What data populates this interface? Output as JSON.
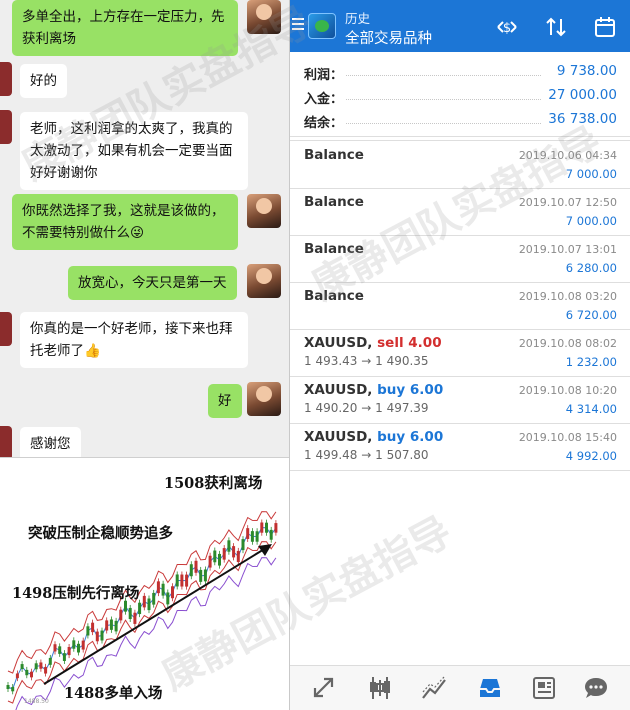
{
  "chat": {
    "messages": [
      {
        "side": "right",
        "text": "多单全出，上方存在一定压力，先获利离场"
      },
      {
        "side": "left",
        "text": "好的"
      },
      {
        "side": "left",
        "text": "老师，这利润拿的太爽了，我真的太激动了，如果有机会一定要当面好好谢谢你"
      },
      {
        "side": "right",
        "text": "你既然选择了我，这就是该做的，不需要特别做什么😜"
      },
      {
        "side": "right",
        "text": "放宽心，今天只是第一天"
      },
      {
        "side": "left",
        "text": "你真的是一个好老师，接下来也拜托老师了👍"
      },
      {
        "side": "right",
        "text": "好"
      },
      {
        "side": "left",
        "text": "感谢您"
      }
    ]
  },
  "chart_annotations": {
    "take_profit": "1508获利离场",
    "breakout": "突破压制企稳顺势追多",
    "first_exit": "1498压制先行离场",
    "entry": "1488多单入场",
    "axis_tick": "1488.50"
  },
  "mt4": {
    "app_title": "历史",
    "app_subtitle": "全部交易品种",
    "summary": [
      {
        "label": "利润：",
        "value": "9 738.00"
      },
      {
        "label": "入金：",
        "value": "27 000.00"
      },
      {
        "label": "结余：",
        "value": "36 738.00"
      }
    ],
    "balances": [
      {
        "title": "Balance",
        "date": "2019.10.06 04:34",
        "amount": "7 000.00"
      },
      {
        "title": "Balance",
        "date": "2019.10.07 12:50",
        "amount": "7 000.00"
      },
      {
        "title": "Balance",
        "date": "2019.10.07 13:01",
        "amount": "6 280.00"
      },
      {
        "title": "Balance",
        "date": "2019.10.08 03:20",
        "amount": "6 720.00"
      }
    ],
    "deals": [
      {
        "symbol": "XAUUSD,",
        "side": "sell",
        "side_text": "sell 4.00",
        "prices": "1 493.43 → 1 490.35",
        "date": "2019.10.08 08:02",
        "amount": "1 232.00"
      },
      {
        "symbol": "XAUUSD,",
        "side": "buy",
        "side_text": "buy 6.00",
        "prices": "1 490.20 → 1 497.39",
        "date": "2019.10.08 10:20",
        "amount": "4 314.00"
      },
      {
        "symbol": "XAUUSD,",
        "side": "buy",
        "side_text": "buy 6.00",
        "prices": "1 499.48 → 1 507.80",
        "date": "2019.10.08 15:40",
        "amount": "4 992.00"
      }
    ],
    "nav_icons": [
      "trade-arrows-icon",
      "candlestick-icon",
      "chart-line-icon",
      "history-inbox-icon",
      "news-icon",
      "chat-icon"
    ],
    "active_nav": 3
  },
  "watermark": "康静团队实盘指导",
  "colors": {
    "accent_blue": "#1c76d6",
    "bubble_green": "#98e165",
    "sell_red": "#d32f2f"
  }
}
